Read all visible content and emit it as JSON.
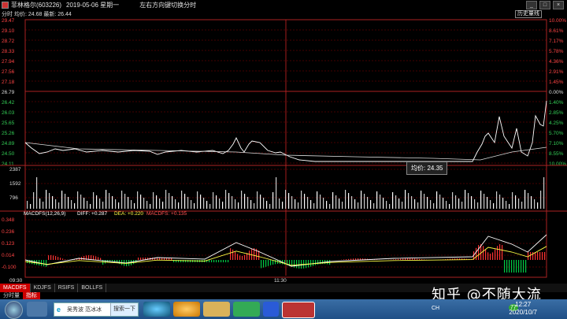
{
  "window": {
    "title_stock": "菲林格尔(603226)",
    "title_date": "2019-05-06 星期一",
    "title_hint": "左右方向键切换分时",
    "buttons": [
      "_",
      "□",
      "×"
    ]
  },
  "subbar": {
    "mode": "分时",
    "avg_label": "均价: 24.68",
    "latest_label": "最新: 26.44",
    "history_button": "历史量线"
  },
  "price_axis": {
    "left": [
      "29.47",
      "29.10",
      "28.72",
      "28.33",
      "27.94",
      "27.56",
      "27.18",
      "26.79",
      "26.42",
      "26.03",
      "25.65",
      "25.26",
      "24.89",
      "24.50",
      "24.11"
    ],
    "right": [
      "10.00%",
      "8.61%",
      "7.17%",
      "5.78%",
      "4.36%",
      "2.91%",
      "1.45%",
      "0.00%",
      "1.40%",
      "2.85%",
      "4.25%",
      "5.70%",
      "7.10%",
      "8.55%",
      "10.00%"
    ],
    "volume": [
      "2387",
      "1592",
      "796"
    ],
    "macd": [
      "0.348",
      "0.236",
      "0.123",
      "0.014",
      "-0.100"
    ],
    "time_start": "09:30",
    "time_mid": "11:30"
  },
  "macd_header": {
    "name": "MACDFS(12,26,9)",
    "diff": "DIFF: +0.287",
    "dea": "DEA: +0.220",
    "macdfs": "MACDFS: +0.135"
  },
  "tooltip": {
    "label": "均价: 24.35"
  },
  "tabs": [
    "MACDFS",
    "KDJFS",
    "RSIFS",
    "BOLLFS"
  ],
  "tabs2": [
    "分时量",
    "指标"
  ],
  "taskbar": {
    "search_logo": "e",
    "search_text": "吴秀波 范冰冰",
    "search_button": "搜索一下",
    "time": "12:27",
    "date": "2020/10/7",
    "tray_badge": "77",
    "tray_lang": "CH"
  },
  "watermark": "知乎 @不随大流",
  "colors": {
    "price_line": "#ffffff",
    "avg_line": "#ffff00",
    "up": "#ff3333",
    "down": "#00cc44",
    "grid": "#8b0000"
  }
}
